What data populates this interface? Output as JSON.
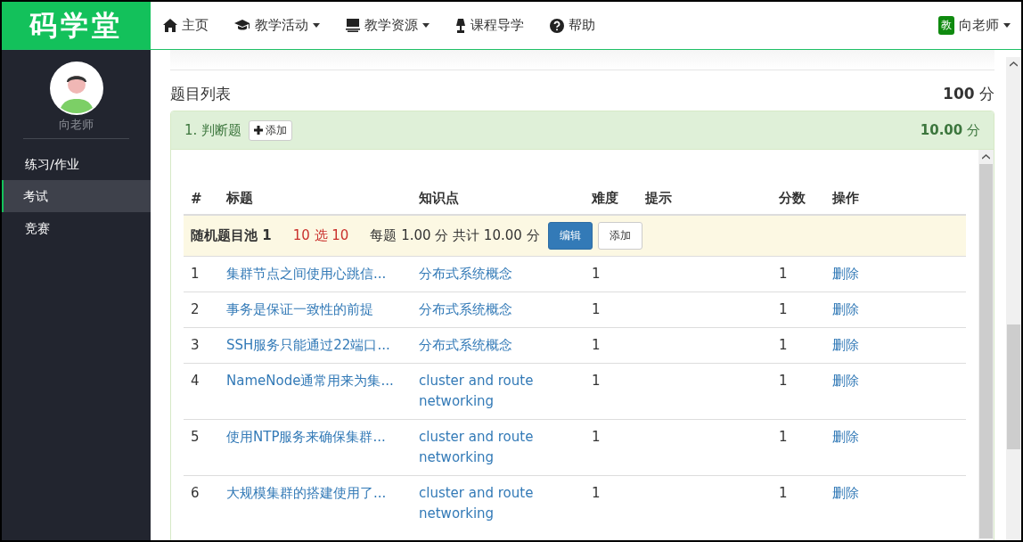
{
  "logo": "码学堂",
  "nav": [
    {
      "label": "主页",
      "kind": "home",
      "dropdown": false
    },
    {
      "label": "教学活动",
      "kind": "activity",
      "dropdown": true
    },
    {
      "label": "教学资源",
      "kind": "resource",
      "dropdown": true
    },
    {
      "label": "课程导学",
      "kind": "guide",
      "dropdown": false
    },
    {
      "label": "帮助",
      "kind": "help",
      "dropdown": false
    }
  ],
  "user": {
    "badge": "教",
    "name": "向老师"
  },
  "sidebar": {
    "name": "向老师",
    "items": [
      {
        "label": "练习/作业",
        "selected": false
      },
      {
        "label": "考试",
        "selected": true
      },
      {
        "label": "竞赛",
        "selected": false
      }
    ]
  },
  "list_title": "题目列表",
  "total": {
    "value": "100",
    "unit": "分"
  },
  "section": {
    "title": "1. 判断题",
    "add_button": "添加",
    "score": "10.00",
    "unit": "分"
  },
  "table": {
    "columns": [
      "#",
      "标题",
      "知识点",
      "难度",
      "提示",
      "分数",
      "操作"
    ],
    "pool": {
      "name": "随机题目池 1",
      "pick": "10 选 10",
      "summary": "每题 1.00 分 共计 10.00 分",
      "edit": "编辑",
      "add": "添加"
    },
    "rows": [
      {
        "num": "1",
        "title": "集群节点之间使用心跳信...",
        "topic": "分布式系统概念",
        "difficulty": "1",
        "score": "1",
        "action": "删除"
      },
      {
        "num": "2",
        "title": "事务是保证一致性的前提",
        "topic": "分布式系统概念",
        "difficulty": "1",
        "score": "1",
        "action": "删除"
      },
      {
        "num": "3",
        "title": "SSH服务只能通过22端口...",
        "topic": "分布式系统概念",
        "difficulty": "1",
        "score": "1",
        "action": "删除"
      },
      {
        "num": "4",
        "title": "NameNode通常用来为集...",
        "topic": "cluster and route networking",
        "difficulty": "1",
        "score": "1",
        "action": "删除"
      },
      {
        "num": "5",
        "title": "使用NTP服务来确保集群...",
        "topic": "cluster and route networking",
        "difficulty": "1",
        "score": "1",
        "action": "删除"
      },
      {
        "num": "6",
        "title": "大规模集群的搭建使用了...",
        "topic": "cluster and route networking",
        "difficulty": "1",
        "score": "1",
        "action": "删除"
      }
    ]
  }
}
